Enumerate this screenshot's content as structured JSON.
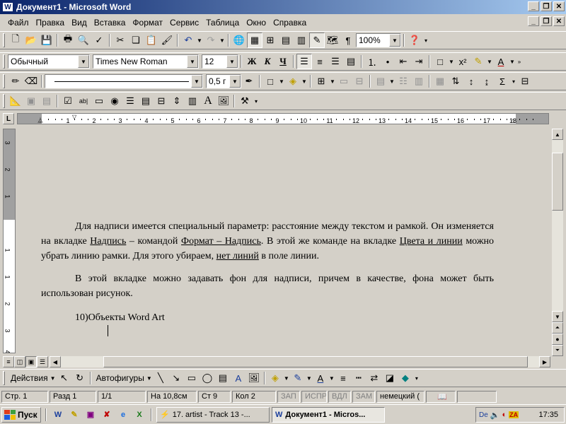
{
  "window": {
    "title": "Документ1 - Microsoft Word",
    "app_icon": "W"
  },
  "menu": [
    "Файл",
    "Правка",
    "Вид",
    "Вставка",
    "Формат",
    "Сервис",
    "Таблица",
    "Окно",
    "Справка"
  ],
  "formatting": {
    "style": "Обычный",
    "font": "Times New Roman",
    "size": "12",
    "bold": "Ж",
    "italic": "К",
    "underline": "Ч"
  },
  "standard": {
    "zoom": "100%",
    "pilcrow": "¶"
  },
  "drawing_line": {
    "width": "0,5 г"
  },
  "ruler": {
    "corner": "L",
    "h_ticks": [
      "1",
      "2",
      "3",
      "4",
      "5",
      "6",
      "7",
      "8",
      "9",
      "10",
      "11",
      "12",
      "13",
      "14",
      "15",
      "16",
      "17",
      "18"
    ],
    "v_ticks": [
      "3",
      "2",
      "1",
      "1",
      "1",
      "2",
      "3",
      "4",
      "5"
    ]
  },
  "document": {
    "p1": [
      "Для надписи имеется специальный параметр: расстояние между текстом и рамкой. Он изменяется на вкладке ",
      "Надпись",
      " – командой ",
      "Формат – Надпись",
      ". В этой же команде на вкладке ",
      "Цвета и линии",
      " можно убрать линию рамки. Для этого убираем, ",
      "нет линий",
      " в поле линии."
    ],
    "p2": "В этой вкладке можно задавать фон для надписи, причем в качестве, фона может быть использован рисунок.",
    "p3": "10)Объекты Word Art"
  },
  "drawbar": {
    "actions": "Действия",
    "autoshapes": "Автофигуры"
  },
  "status": {
    "page": "Стр. 1",
    "section": "Разд 1",
    "pages": "1/1",
    "at": "На 10,8см",
    "line": "Ст 9",
    "col": "Кол 2",
    "rec": "ЗАП",
    "trk": "ИСПР",
    "ext": "ВДЛ",
    "ovr": "ЗАМ",
    "lang": "немецкий ("
  },
  "taskbar": {
    "start": "Пуск",
    "tasks": [
      "17. artist - Track 13 -...",
      "Документ1 - Micros..."
    ],
    "lang": "De",
    "clock": "17:35"
  },
  "colors": {
    "title_start": "#0a246a",
    "title_end": "#a6caf0",
    "face": "#d4d0c8"
  }
}
